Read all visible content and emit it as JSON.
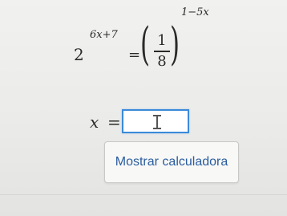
{
  "equation": {
    "base": "2",
    "base_exponent": "6x+7",
    "equals": "=",
    "fraction_numerator": "1",
    "fraction_denominator": "8",
    "outer_exponent": "1−5x"
  },
  "answer": {
    "variable": "x",
    "equals": "=",
    "input_value": ""
  },
  "calculator_button": {
    "label": "Mostrar calculadora"
  },
  "colors": {
    "input_border": "#3b8ad9",
    "button_text": "#2a5d9f",
    "background": "#ebebe9"
  },
  "icons": {
    "input_cursor": "text-cursor-icon"
  }
}
